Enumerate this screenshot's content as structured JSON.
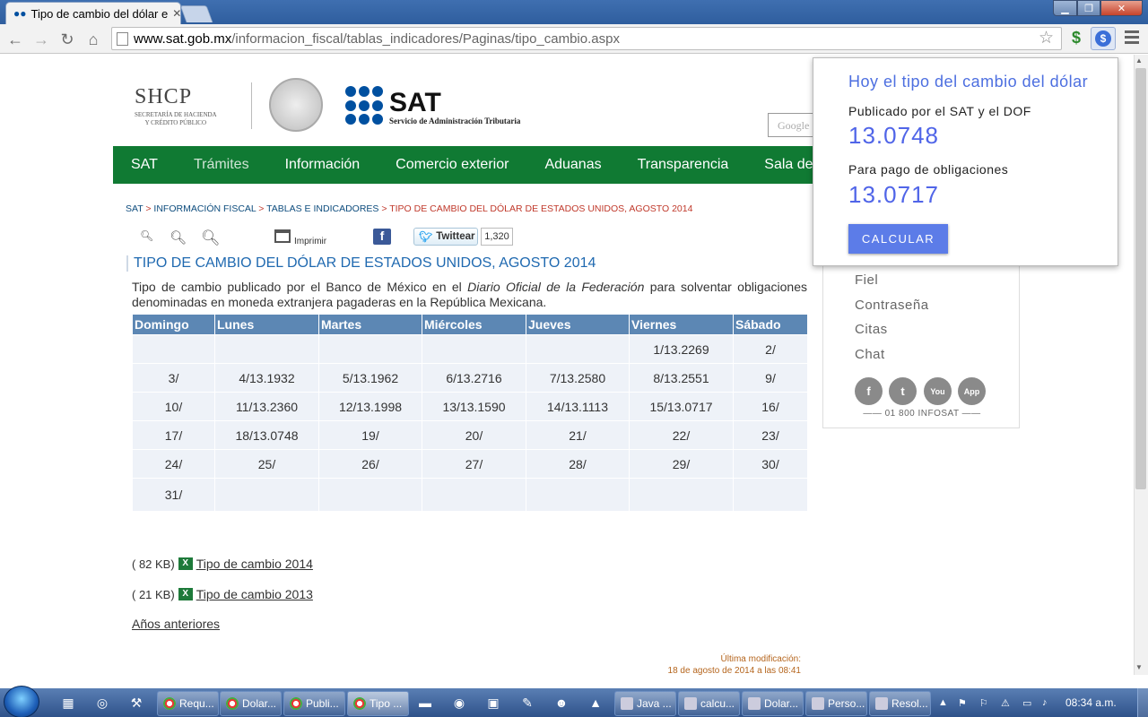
{
  "browser": {
    "tab_title": "Tipo de cambio del dólar e",
    "url_host": "www.sat.gob.mx",
    "url_path": "/informacion_fiscal/tablas_indicadores/Paginas/tipo_cambio.aspx"
  },
  "header": {
    "shcp_big": "SHCP",
    "shcp_small_1": "SECRETARÍA DE HACIENDA",
    "shcp_small_2": "Y CRÉDITO PÚBLICO",
    "sat_big": "SAT",
    "sat_small": "Servicio de Administración Tributaria",
    "search_placeholder": "Google"
  },
  "nav": [
    "SAT",
    "Trámites",
    "Información",
    "Comercio exterior",
    "Aduanas",
    "Transparencia",
    "Sala de"
  ],
  "breadcrumb": {
    "items": [
      "SAT",
      "INFORMACIÓN FISCAL",
      "TABLAS E INDICADORES"
    ],
    "current": "TIPO DE CAMBIO DEL DÓLAR DE ESTADOS UNIDOS, AGOSTO 2014",
    "sep": " > "
  },
  "tools": {
    "print_label": "Imprimir",
    "twitter_label": "Twittear",
    "twitter_count": "1,320"
  },
  "page": {
    "title": "TIPO DE CAMBIO DEL DÓLAR DE ESTADOS UNIDOS, AGOSTO 2014",
    "intro_1": "Tipo de cambio publicado por el Banco de México en el ",
    "intro_em": "Diario Oficial de la Federación",
    "intro_2": " para solventar obligaciones denominadas en moneda extranjera pagaderas en la República Mexicana."
  },
  "calendar": {
    "headers": [
      "Domingo",
      "Lunes",
      "Martes",
      "Miércoles",
      "Jueves",
      "Viernes",
      "Sábado"
    ],
    "rows": [
      [
        "",
        "",
        "",
        "",
        "",
        "1/13.2269",
        "2/"
      ],
      [
        "3/",
        "4/13.1932",
        "5/13.1962",
        "6/13.2716",
        "7/13.2580",
        "8/13.2551",
        "9/"
      ],
      [
        "10/",
        "11/13.2360",
        "12/13.1998",
        "13/13.1590",
        "14/13.1113",
        "15/13.0717",
        "16/"
      ],
      [
        "17/",
        "18/13.0748",
        "19/",
        "20/",
        "21/",
        "22/",
        "23/"
      ],
      [
        "24/",
        "25/",
        "26/",
        "27/",
        "28/",
        "29/",
        "30/"
      ],
      [
        "31/",
        "",
        "",
        "",
        "",
        "",
        ""
      ]
    ]
  },
  "downloads": [
    {
      "size": "( 82 KB)",
      "label": "Tipo de cambio 2014"
    },
    {
      "size": "( 21 KB)",
      "label": "Tipo de cambio 2013"
    }
  ],
  "previous_years": "Años anteriores",
  "modified": {
    "label": "Última modificación:",
    "date": "18 de agosto de 2014 a las 08:41"
  },
  "sidebar": {
    "items": [
      "Fiel",
      "Contraseña",
      "Citas",
      "Chat"
    ],
    "phone": "01 800 INFOSAT",
    "social": [
      "f",
      "t",
      "You",
      "App"
    ]
  },
  "popup": {
    "title": "Hoy el tipo del cambio del dólar",
    "label_sat": "Publicado por el SAT y el DOF",
    "value_sat": "13.0748",
    "label_obligaciones": "Para pago de obligaciones",
    "value_obligaciones": "13.0717",
    "button": "CALCULAR"
  },
  "taskbar": {
    "tasks": [
      "Requ...",
      "Dolar...",
      "Publi...",
      "Tipo ...",
      "Java ...",
      "calcu...",
      "Dolar...",
      "Perso...",
      "Resol..."
    ],
    "clock": "08:34 a.m."
  },
  "colors": {
    "nav_green": "#107a33",
    "table_header": "#5c87b4",
    "popup_accent": "#5065e8",
    "sat_blue": "#0050a0"
  }
}
